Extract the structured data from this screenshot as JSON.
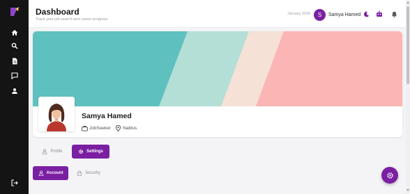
{
  "header": {
    "title": "Dashboard",
    "subtitle": "Track your job search and career progress",
    "date": "January 2026",
    "user_initial": "S",
    "user_name": "Samya Hamed"
  },
  "sidebar": {
    "items": [
      {
        "icon": "home-icon"
      },
      {
        "icon": "search-icon"
      },
      {
        "icon": "document-icon"
      },
      {
        "icon": "chat-icon"
      },
      {
        "icon": "person-icon"
      }
    ],
    "logout_icon": "logout-icon"
  },
  "profile": {
    "name": "Samya Hamed",
    "role": "JobSeeker",
    "location": "Nablus"
  },
  "tabs": {
    "profile": "Profile",
    "settings": "Settings"
  },
  "subtabs": {
    "account": "Account",
    "security": "Security"
  },
  "colors": {
    "accent": "#7b1fa2",
    "sidebar": "#141414",
    "banner_teal": "#5fc1bf",
    "banner_mint": "#b4dfd6",
    "banner_cream": "#f5e1d6",
    "banner_pink": "#fbb5b4"
  }
}
